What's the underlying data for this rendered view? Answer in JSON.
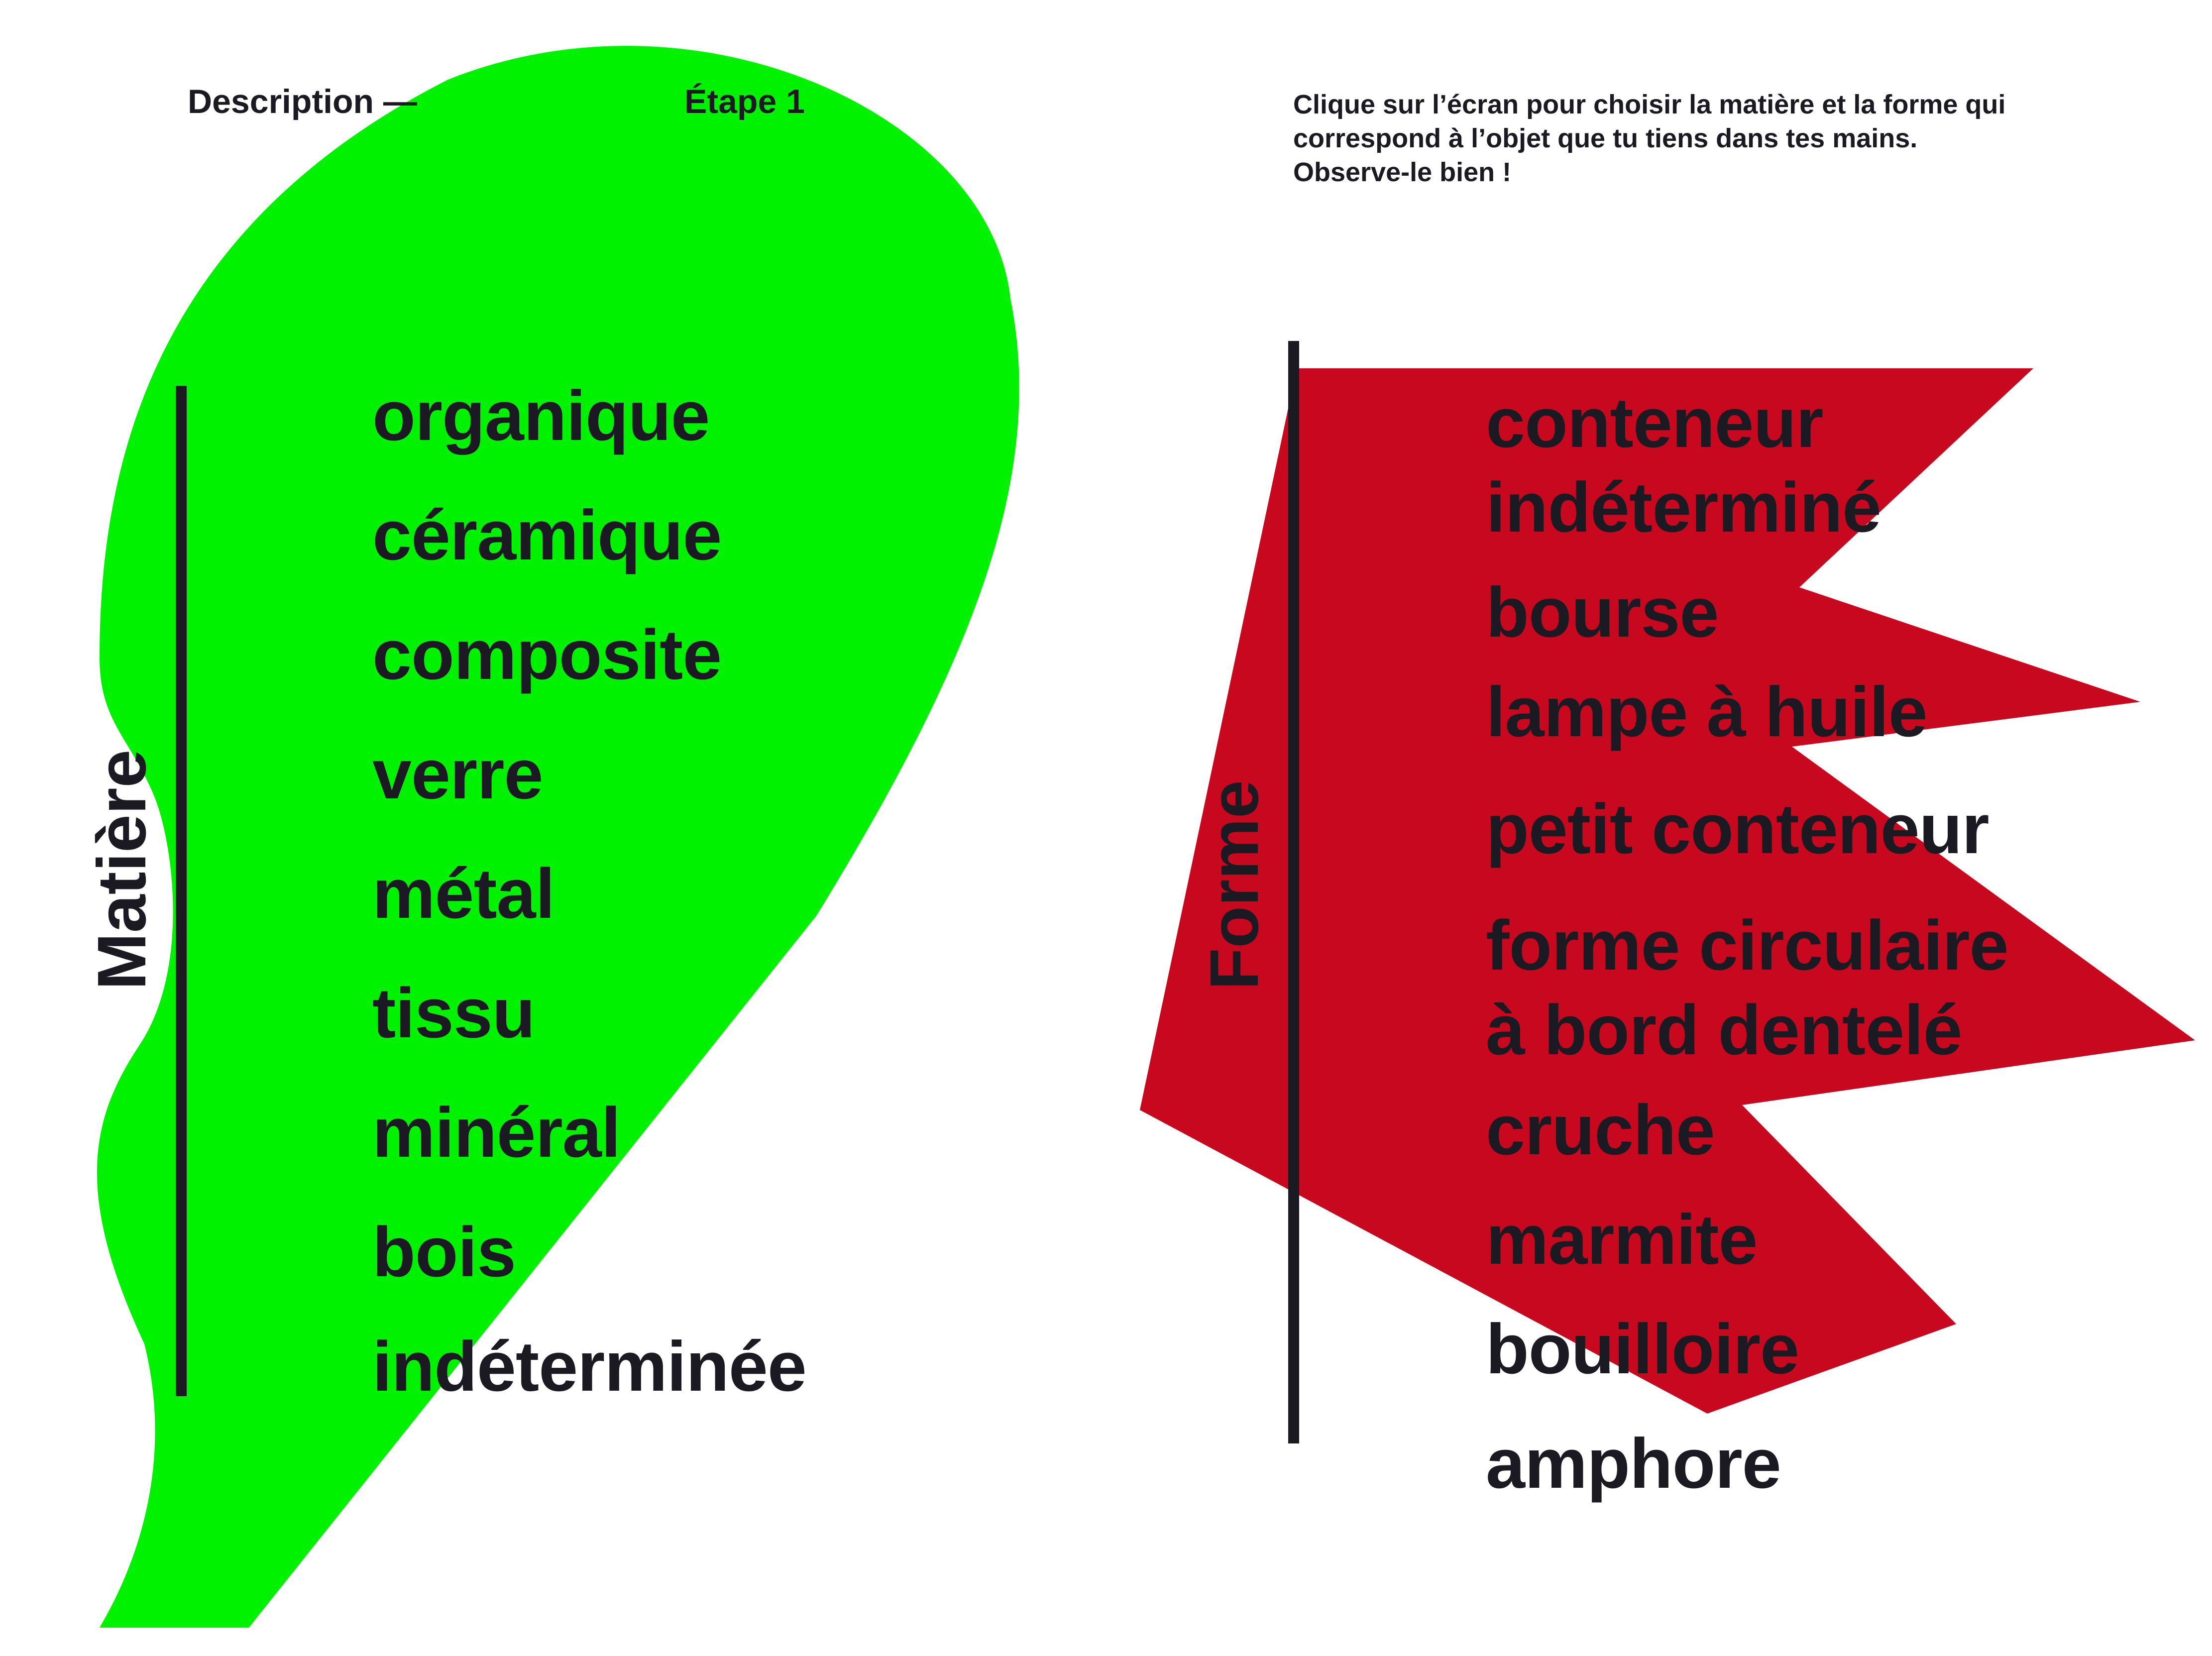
{
  "header": {
    "left_label": "Description —",
    "step_label": "Étape 1"
  },
  "instructions": {
    "line1": "Clique sur l’écran pour choisir la matière et la forme qui",
    "line2": "correspond à l’objet que tu tiens dans tes mains.",
    "line3": "Observe-le bien !"
  },
  "matiere": {
    "title": "Matière",
    "options": [
      "organique",
      "céramique",
      "composite",
      "verre",
      "métal",
      "tissu",
      "minéral",
      "bois",
      "indéterminée"
    ]
  },
  "forme": {
    "title": "Forme",
    "options": [
      [
        "conteneur",
        "indéterminé"
      ],
      [
        "bourse"
      ],
      [
        "lampe à huile"
      ],
      [
        "petit conteneur"
      ],
      [
        "forme circulaire",
        "à bord dentelé"
      ],
      [
        "cruche"
      ],
      [
        "marmite"
      ],
      [
        "bouilloire"
      ],
      [
        "amphore"
      ]
    ]
  },
  "colors": {
    "green": "#00f200",
    "red": "#c8081f",
    "ink": "#1b1a22"
  }
}
